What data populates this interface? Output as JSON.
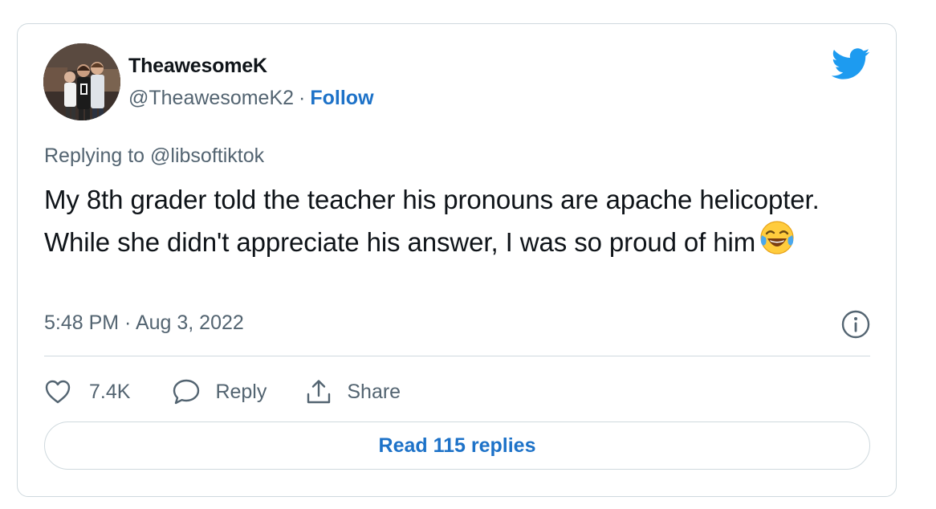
{
  "author": {
    "display_name": "TheawesomeK",
    "handle": "@TheawesomeK2",
    "separator": "·",
    "follow_label": "Follow"
  },
  "reply_context": {
    "prefix": "Replying to",
    "mention": "@libsoftiktok"
  },
  "tweet": {
    "text": "My 8th grader told the teacher his pronouns are apache helicopter.  While she didn't appreciate his answer, I was so proud of him",
    "emoji": "face-with-tears-of-joy",
    "timestamp": "5:48 PM · Aug 3, 2022"
  },
  "actions": {
    "like_count": "7.4K",
    "reply_label": "Reply",
    "share_label": "Share"
  },
  "read_replies_label": "Read 115 replies",
  "colors": {
    "brand": "#1d9bf0",
    "link": "#1d72c8",
    "secondary_text": "#536471",
    "border": "#cfd9de"
  },
  "icons": {
    "brand": "twitter-bird-icon",
    "info": "info-icon",
    "like": "heart-icon",
    "reply": "speech-bubble-icon",
    "share": "share-upload-icon"
  }
}
